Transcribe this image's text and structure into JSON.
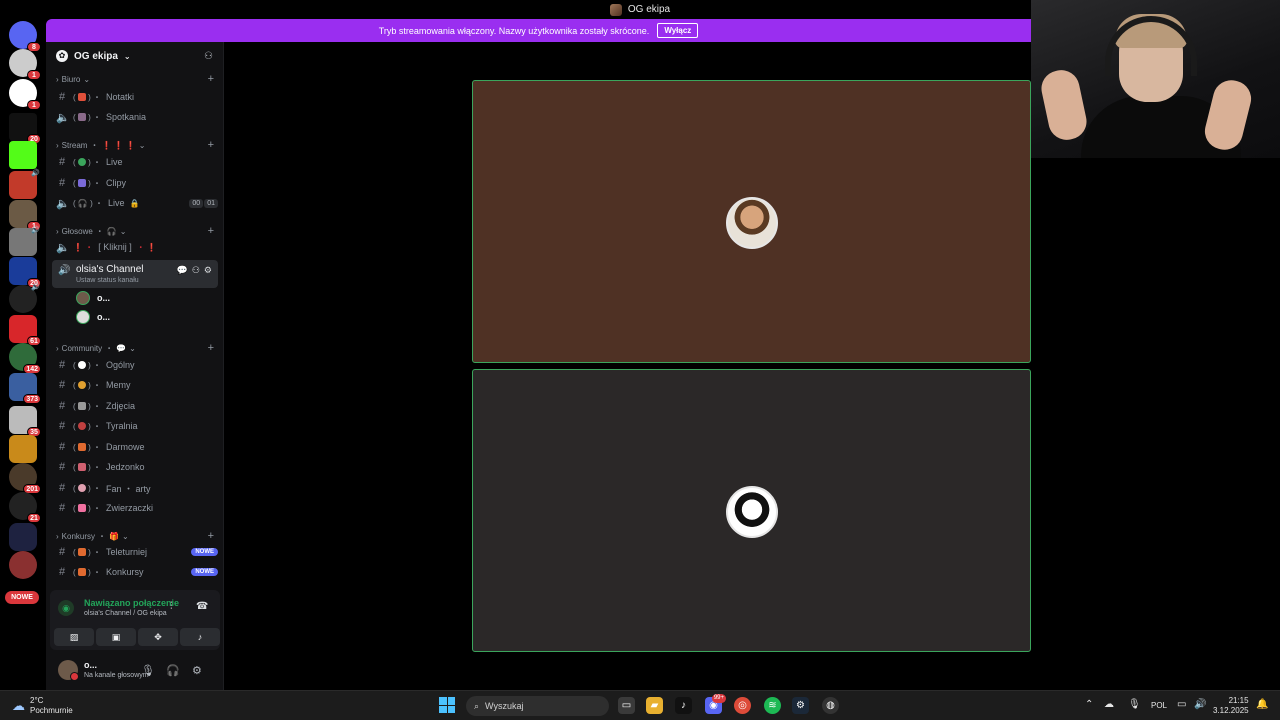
{
  "window": {
    "title": "OG ekipa"
  },
  "banner": {
    "message": "Tryb streamowania włączony. Nazwy użytkownika zostały skrócone.",
    "button": "Wyłącz"
  },
  "rail": {
    "badges": [
      "8",
      "1",
      "1",
      "20",
      "1",
      "20",
      "61",
      "142",
      "373",
      "35",
      "201",
      "21"
    ],
    "new_label": "NOWE"
  },
  "server": {
    "name": "OG ekipa"
  },
  "categories": {
    "biuro": {
      "name": "Biuro"
    },
    "stream": {
      "name": "Stream",
      "suffix": "❗ ❗ ❗"
    },
    "glosowe": {
      "name": "Głosowe",
      "suffix": "🎧"
    },
    "community": {
      "name": "Community",
      "suffix": "💬"
    },
    "konkursy": {
      "name": "Konkursy",
      "suffix": "🎁"
    }
  },
  "channels": {
    "notatki": "Notatki",
    "spotkania": "Spotkania",
    "live": "Live",
    "clipy": "Clipy",
    "live_voice": "Live",
    "live_limit": [
      "00",
      "01"
    ],
    "kliknij": "[ Kliknij ]",
    "active": {
      "name": "olsia's Channel",
      "status": "Ustaw status kanału"
    },
    "ogolny": "Ogólny",
    "memy": "Memy",
    "zdjecia": "Zdjęcia",
    "tyralnia": "Tyralnia",
    "darmowe": "Darmowe",
    "jedzonko": "Jedzonko",
    "fan_arty": "Fan ・ arty",
    "zwierzaczki": "Zwierzaczki",
    "teleturniej": "Teleturniej",
    "konkursy": "Konkursy",
    "new_tag": "NOWE"
  },
  "members": [
    "o...",
    "o..."
  ],
  "voice": {
    "status": "Nawiązano połączenie",
    "location": "olsia's Channel / OG ekipa"
  },
  "user": {
    "name": "o...",
    "status": "Na kanale głosowym"
  },
  "taskbar": {
    "weather_temp": "2°C",
    "weather_desc": "Pochmurnie",
    "search_placeholder": "Wyszukaj",
    "discord_badge": "99+",
    "lang": "POL",
    "time": "21:15",
    "date": "3.12.2025"
  },
  "colors": {
    "accent_banner": "#9a2ef0",
    "speaking_border": "#3ba55c",
    "tile1": "#4f3124",
    "tile2": "#2b2828"
  }
}
